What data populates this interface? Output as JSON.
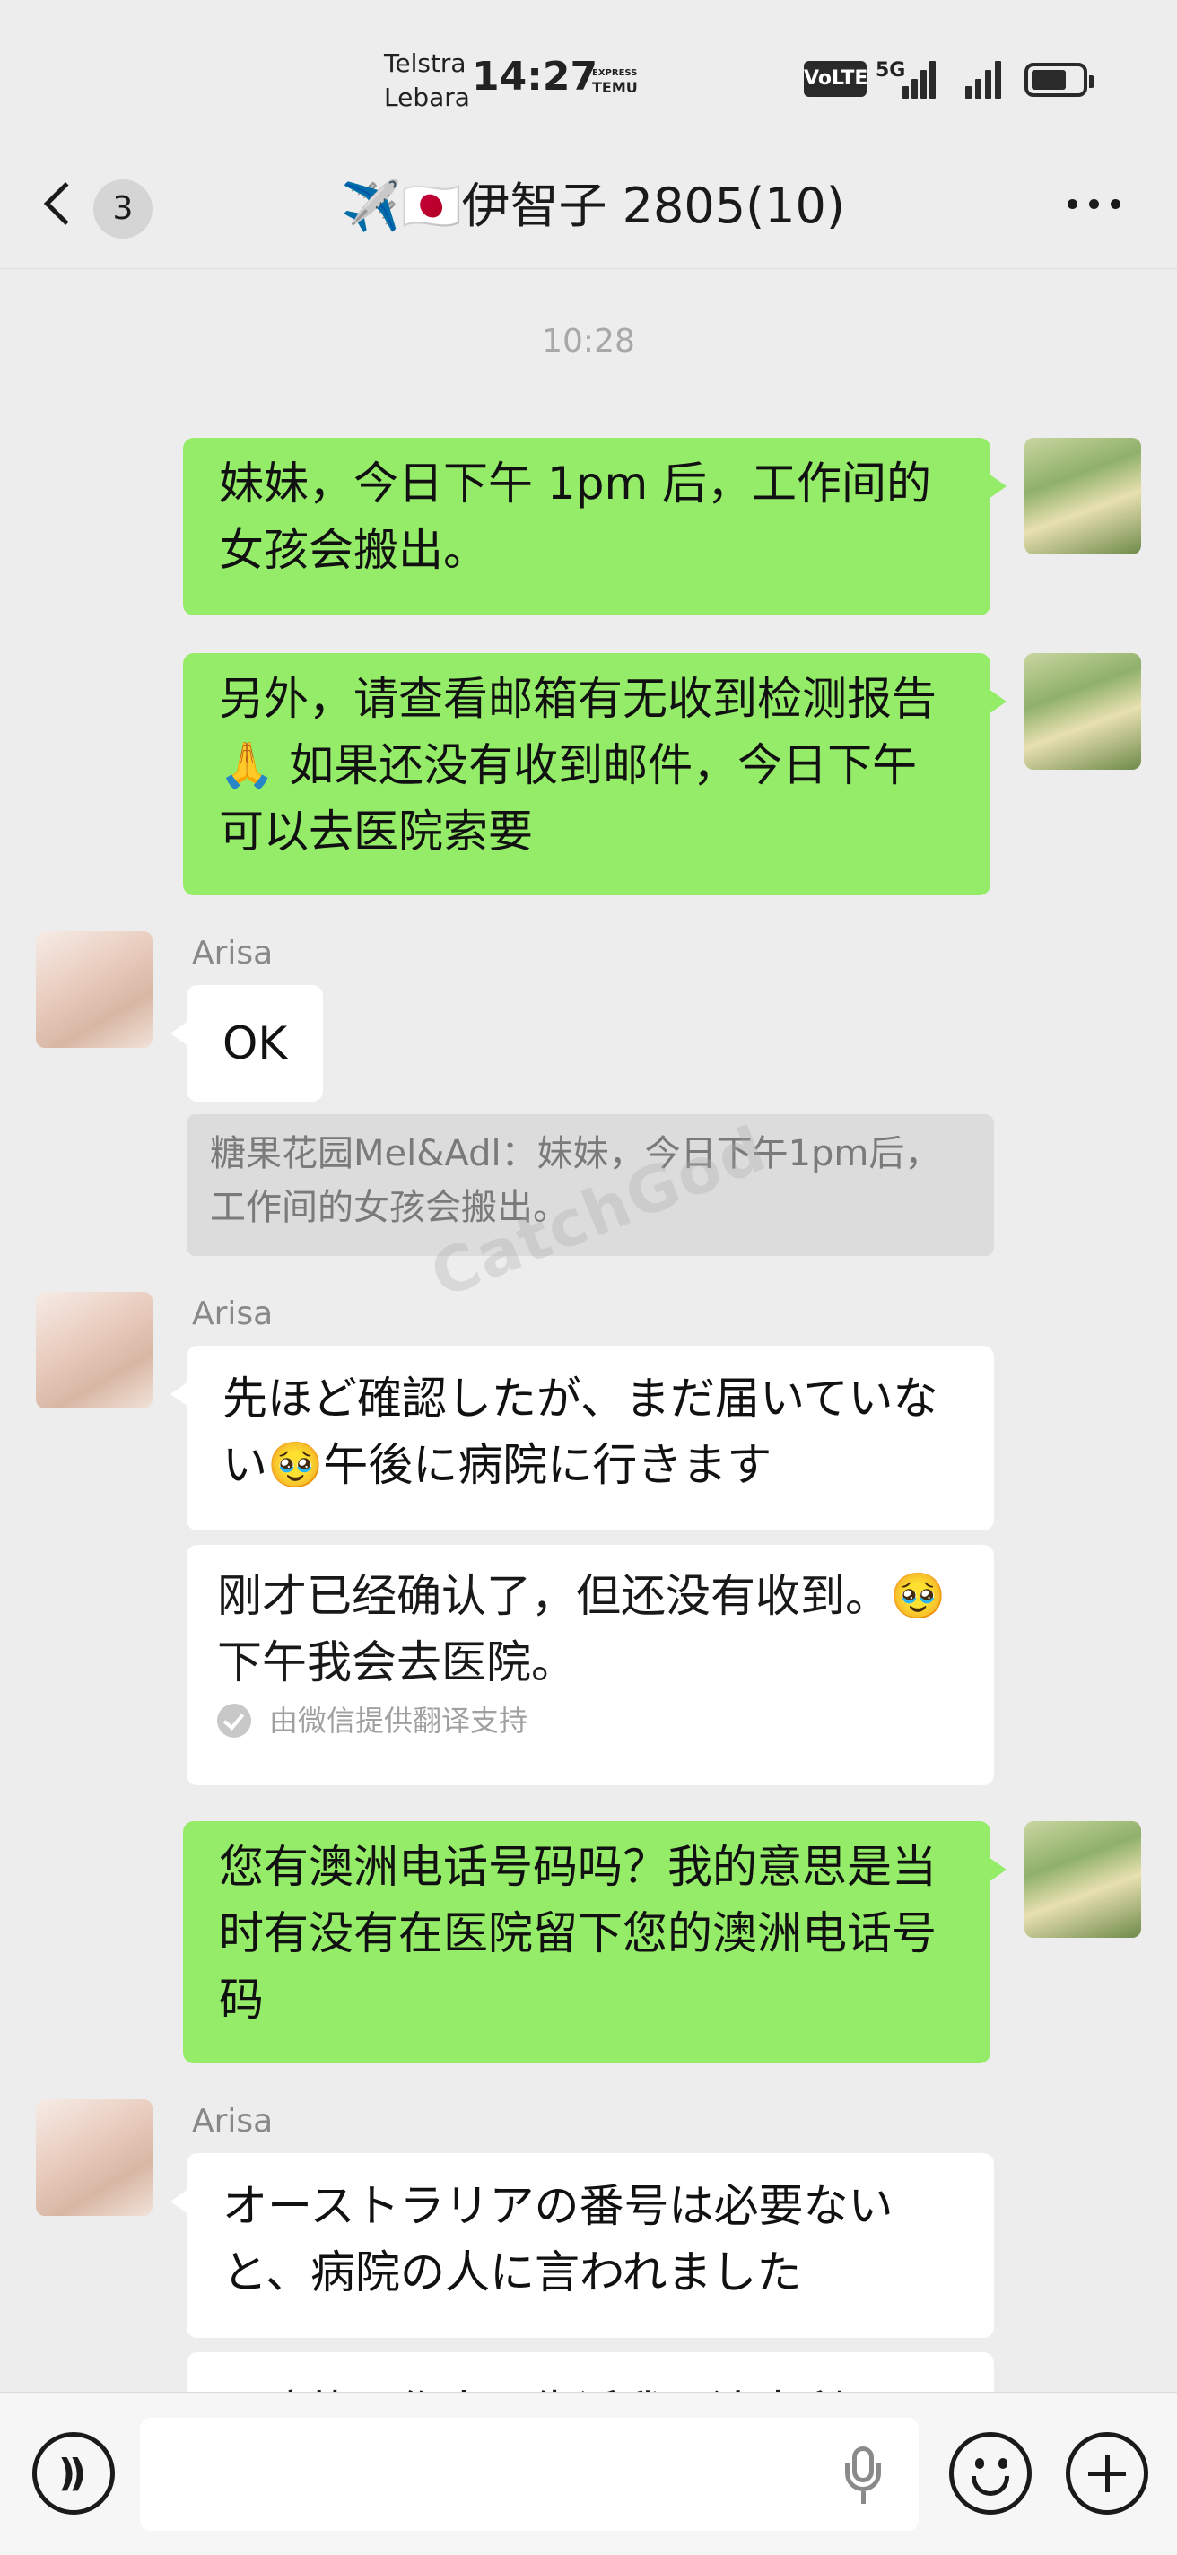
{
  "status_bar": {
    "carrier_1": "Telstra",
    "carrier_2": "Lebara",
    "time": "14:27",
    "app_tag_1": "EXPRESS",
    "app_tag_2": "TEMU",
    "volte": "VoLTE",
    "network": "5G"
  },
  "header": {
    "unread_count": "3",
    "title": "✈️🇯🇵伊智子 2805(10)"
  },
  "messages": {
    "timestamp": "10:28",
    "m1": "妹妹，今日下午 1pm 后，工作间的女孩会搬出。",
    "m2": "另外，请查看邮箱有无收到检测报告🙏 如果还没有收到邮件，今日下午可以去医院索要",
    "arisa_1": {
      "sender": "Arisa",
      "text": "OK"
    },
    "quote": "糖果花园Mel&Adl：妹妹，今日下午1pm后，工作间的女孩会搬出。",
    "arisa_2": {
      "sender": "Arisa",
      "text": "先ほど確認したが、まだ届いていない🥹午後に病院に行きます",
      "translation": "刚才已经确认了，但还没有收到。🥹下午我会去医院。",
      "translation_note": "由微信提供翻译支持"
    },
    "m3": "您有澳洲电话号码吗？我的意思是当时有没有在医院留下您的澳洲电话号码",
    "arisa_3": {
      "sender": "Arisa",
      "text": "オーストラリアの番号は必要ないと、病院の人に言われました"
    },
    "arisa_4_partial": "医院的工作人员告诉我，澳大利亚"
  },
  "watermark": "CatchGod",
  "input_bar": {
    "placeholder": ""
  }
}
